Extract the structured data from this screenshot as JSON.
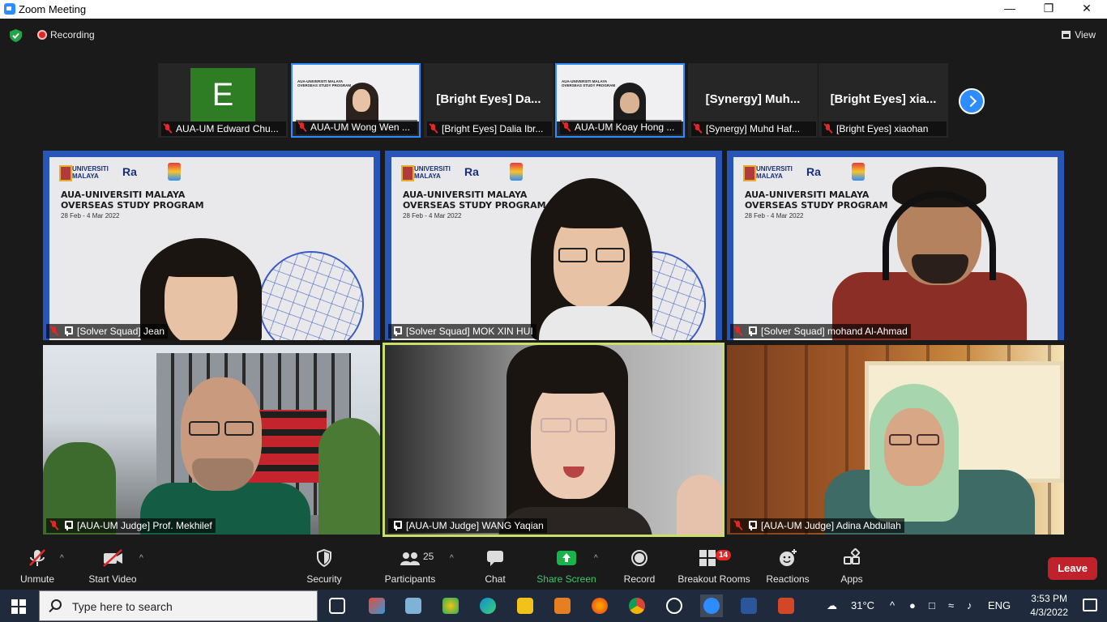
{
  "window": {
    "title": "Zoom Meeting"
  },
  "infobar": {
    "recording_label": "Recording",
    "view_label": "View"
  },
  "thumbnails": [
    {
      "label": "AUA-UM Edward Chu...",
      "avatar_letter": "E",
      "type": "avatar"
    },
    {
      "label": "AUA-UM Wong Wen ...",
      "type": "video"
    },
    {
      "label": "[Bright Eyes] Dalia Ibr...",
      "display_name": "[Bright Eyes]  Da...",
      "type": "name"
    },
    {
      "label": "AUA-UM Koay Hong ...",
      "type": "video"
    },
    {
      "label": "[Synergy]  Muhd Haf...",
      "display_name": "[Synergy]   Muh...",
      "type": "name"
    },
    {
      "label": "[Bright Eyes] xiaohan",
      "display_name": "[Bright Eyes]  xia...",
      "type": "name"
    }
  ],
  "slide": {
    "logo_um": "UNIVERSITI MALAYA",
    "logo_aua": "Ra",
    "heading_line1": "AUA-UNIVERSITI MALAYA",
    "heading_line2": "OVERSEAS STUDY PROGRAM",
    "dates": "28 Feb - 4 Mar 2022"
  },
  "tiles": [
    {
      "name": "[Solver Squad] Jean",
      "muted": true
    },
    {
      "name": "[Solver Squad] MOK XIN HUI",
      "muted": false
    },
    {
      "name": "[Solver Squad] mohand Al-Ahmad",
      "muted": true
    },
    {
      "name": "[AUA-UM Judge] Prof. Mekhilef",
      "muted": true
    },
    {
      "name": "[AUA-UM Judge] WANG Yaqian",
      "muted": false
    },
    {
      "name": "[AUA-UM Judge] Adina Abdullah",
      "muted": true
    }
  ],
  "toolbar": {
    "unmute": "Unmute",
    "start_video": "Start Video",
    "security": "Security",
    "participants": "Participants",
    "participants_count": "25",
    "chat": "Chat",
    "share_screen": "Share Screen",
    "record": "Record",
    "breakout_rooms": "Breakout Rooms",
    "breakout_count": "14",
    "reactions": "Reactions",
    "apps": "Apps",
    "leave": "Leave"
  },
  "taskbar": {
    "search_placeholder": "Type here to search",
    "temperature": "31°C",
    "language": "ENG",
    "time": "3:53 PM",
    "date": "4/3/2022"
  },
  "colors": {
    "zoom_blue": "#2d8cff",
    "share_green": "#18b34a",
    "leave_red": "#c0222b",
    "speaker_border": "#c8e06a",
    "slide_frame": "#2856b8"
  }
}
